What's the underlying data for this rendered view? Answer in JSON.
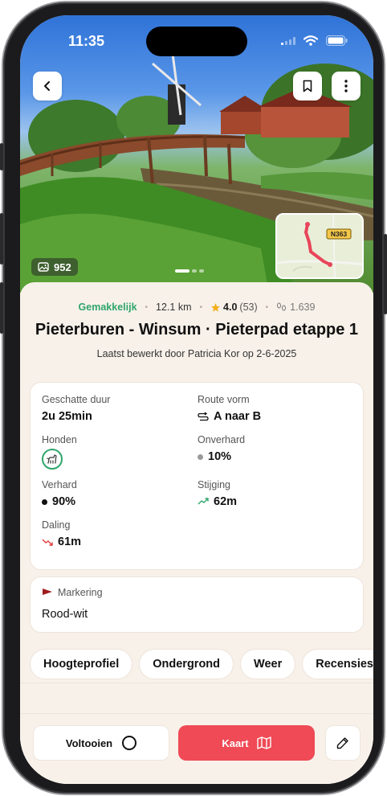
{
  "status": {
    "time": "11:35"
  },
  "hero": {
    "photo_count": "952",
    "carousel_pages": 3,
    "carousel_active": 1,
    "map_road_label": "N363"
  },
  "meta": {
    "difficulty": "Gemakkelijk",
    "distance": "12.1 km",
    "rating": "4.0",
    "rating_count": "(53)",
    "hikers": "1.639"
  },
  "title": "Pieterburen - Winsum · Pieterpad etappe 1",
  "subtitle": "Laatst bewerkt door Patricia Kor op 2-6-2025",
  "stats": {
    "duration_label": "Geschatte duur",
    "duration_value": "2u 25min",
    "shape_label": "Route vorm",
    "shape_value": "A naar B",
    "dogs_label": "Honden",
    "unpaved_label": "Onverhard",
    "unpaved_value": "10%",
    "paved_label": "Verhard",
    "paved_value": "90%",
    "ascent_label": "Stijging",
    "ascent_value": "62m",
    "descent_label": "Daling",
    "descent_value": "61m"
  },
  "marking": {
    "label": "Markering",
    "value": "Rood-wit"
  },
  "chips": [
    "Hoogteprofiel",
    "Ondergrond",
    "Weer",
    "Recensies"
  ],
  "actions": {
    "complete": "Voltooien",
    "map": "Kaart"
  },
  "colors": {
    "accent": "#ef4a55",
    "easy": "#2fa56b",
    "star": "#f2b01e",
    "sheet_bg": "#f8f1ea"
  }
}
